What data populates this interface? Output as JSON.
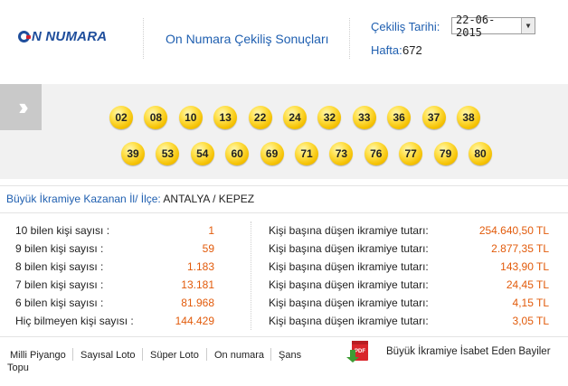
{
  "header": {
    "logo_text": "N NUMARA",
    "page_title": "On Numara Çekiliş Sonuçları",
    "date_label": "Çekiliş Tarihi:",
    "date_value": "22-06-2015",
    "week_label": "Hafta:",
    "week_value": "672"
  },
  "balls": {
    "row1": [
      "02",
      "08",
      "10",
      "13",
      "22",
      "24",
      "32",
      "33",
      "36",
      "37",
      "38"
    ],
    "row2": [
      "39",
      "53",
      "54",
      "60",
      "69",
      "71",
      "73",
      "76",
      "77",
      "79",
      "80"
    ]
  },
  "winner": {
    "label": "Büyük İkramiye Kazanan İl/ İlçe:",
    "location": "ANTALYA / KEPEZ"
  },
  "results": [
    {
      "label": "10 bilen kişi sayısı :",
      "count": "1",
      "desc": "Kişi başına düşen ikramiye tutarı:",
      "prize": "254.640,50 TL"
    },
    {
      "label": "9 bilen kişi sayısı :",
      "count": "59",
      "desc": "Kişi başına düşen ikramiye tutarı:",
      "prize": "2.877,35 TL"
    },
    {
      "label": "8 bilen kişi sayısı :",
      "count": "1.183",
      "desc": "Kişi başına düşen ikramiye tutarı:",
      "prize": "143,90 TL"
    },
    {
      "label": "7 bilen kişi sayısı :",
      "count": "13.181",
      "desc": "Kişi başına düşen ikramiye tutarı:",
      "prize": "24,45 TL"
    },
    {
      "label": "6 bilen kişi sayısı :",
      "count": "81.968",
      "desc": "Kişi başına düşen ikramiye tutarı:",
      "prize": "4,15 TL"
    },
    {
      "label": "Hiç bilmeyen kişi sayısı :",
      "count": "144.429",
      "desc": "Kişi başına düşen ikramiye tutarı:",
      "prize": "3,05 TL"
    }
  ],
  "footer": {
    "links": [
      "Milli Piyango",
      "Sayısal Loto",
      "Süper Loto",
      "On numara",
      "Şans"
    ],
    "wrap_text": "Topu",
    "pdf_icon_label": "PDF",
    "bayiler_link": "Büyük İkramiye İsabet Eden Bayiler"
  },
  "colors": {
    "brand_blue": "#1f5fb0",
    "value_orange": "#e25b0b",
    "ball_yellow": "#f4c000",
    "pdf_red": "#d9262b"
  }
}
